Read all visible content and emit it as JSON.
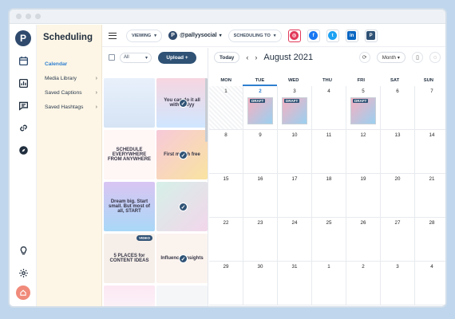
{
  "window": {
    "title": ""
  },
  "app": {
    "logo": "P",
    "section_title": "Scheduling",
    "subnav": [
      {
        "label": "Calendar",
        "chevron": "›"
      },
      {
        "label": "Media Library",
        "chevron": "›"
      },
      {
        "label": "Saved Captions",
        "chevron": "›"
      },
      {
        "label": "Saved Hashtags",
        "chevron": "›"
      }
    ]
  },
  "topbar": {
    "viewing_label": "VIEWING",
    "account_name": "@pallyysocial",
    "scheduling_to_label": "SCHEDULING TO",
    "platforms": [
      {
        "name": "instagram-icon",
        "glyph": "◎",
        "color": "#e23a5a"
      },
      {
        "name": "facebook-icon",
        "glyph": "f",
        "color": "#1877f2"
      },
      {
        "name": "twitter-icon",
        "glyph": "t",
        "color": "#1da1f2"
      },
      {
        "name": "linkedin-icon",
        "glyph": "in",
        "color": "#0a66c2"
      },
      {
        "name": "pinterest-icon",
        "glyph": "P",
        "color": "#2f5275"
      }
    ]
  },
  "media": {
    "filter_value": "All",
    "upload_label": "Upload +",
    "tiles": [
      {
        "text": "",
        "checked": false,
        "video": false,
        "bg": "linear-gradient(180deg,#e8f0fb,#d6e4f5)"
      },
      {
        "text": "You can do it all with Pallyy",
        "checked": true,
        "video": false,
        "bg": "linear-gradient(180deg,#f7d6e0,#cfe6ff)"
      },
      {
        "text": "SCHEDULE EVERYWHERE FROM ANYWHERE",
        "checked": false,
        "video": false,
        "bg": "#fff6f6"
      },
      {
        "text": "First month free",
        "checked": true,
        "video": false,
        "bg": "linear-gradient(135deg,#f7c9d9,#f9e3a0)"
      },
      {
        "text": "Dream big. Start small. But most of all, START",
        "checked": false,
        "video": false,
        "bg": "linear-gradient(180deg,#d9c5f3,#a9d8f7)"
      },
      {
        "text": "",
        "checked": true,
        "video": false,
        "bg": "linear-gradient(135deg,#d5f0e8,#f2d6ea)"
      },
      {
        "text": "5 PLACES for CONTENT IDEAS",
        "checked": false,
        "video": true,
        "video_label": "VIDEO",
        "bg": "#f6efe9"
      },
      {
        "text": "Influencer Insights",
        "checked": true,
        "video": false,
        "bg": "#fbf3ee"
      },
      {
        "text": "",
        "checked": false,
        "video": false,
        "bg": "linear-gradient(180deg,#fbe7f2,#ffffff)"
      },
      {
        "text": "",
        "checked": false,
        "video": false,
        "bg": "#f4f6f8"
      }
    ]
  },
  "calendar": {
    "today_label": "Today",
    "prev_label": "‹",
    "next_label": "›",
    "month_title": "August 2021",
    "view_label": "Month",
    "days_of_week": [
      "MON",
      "TUE",
      "WED",
      "THU",
      "FRI",
      "SAT",
      "SUN"
    ],
    "today_day": "2",
    "weeks": [
      [
        "1",
        "2",
        "3",
        "4",
        "5",
        "6",
        "7"
      ],
      [
        "8",
        "9",
        "10",
        "11",
        "12",
        "13",
        "14"
      ],
      [
        "15",
        "16",
        "17",
        "18",
        "19",
        "20",
        "21"
      ],
      [
        "22",
        "23",
        "24",
        "25",
        "26",
        "27",
        "28"
      ],
      [
        "29",
        "30",
        "31",
        "1",
        "2",
        "3",
        "4"
      ]
    ],
    "draft_label": "DRAFT",
    "drafts_on": [
      "2",
      "3",
      "5"
    ]
  }
}
